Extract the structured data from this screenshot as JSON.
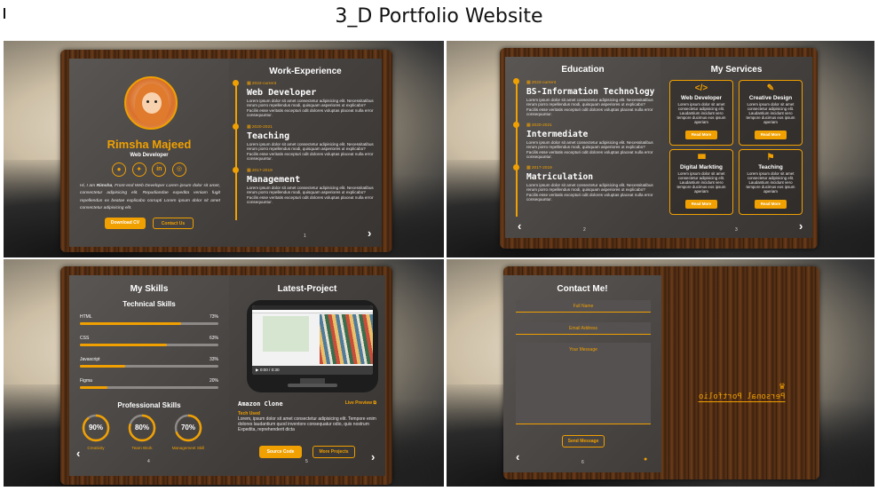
{
  "document": {
    "title": "3_D Portfolio Website"
  },
  "panel1": {
    "name": "Rimsha Majeed",
    "role": "Web Developer",
    "intro_prefix": "Hi, I am ",
    "intro_name": "Rimsha",
    "intro_rest": ", Front-end Web Developer Lorem ipsum dolor sit amet, consectetur adipisicing elit. Repudiandae expedita veniam fugit repellendus ex beatae explicabo corrupti Lorem ipsum dolor sit amet consectetur adipisicing elit.",
    "social_icons": [
      "github-icon",
      "twitter-icon",
      "linkedin-icon",
      "instagram-icon"
    ],
    "download_cv": "Download CV",
    "contact_us": "Contact Us",
    "heading": "Work-Experience",
    "items": [
      {
        "date": "2022-current",
        "title": "Web Developer",
        "text": "Lorem ipsum dolor sit amet consectetur adipisicing elit. Necessitatibus rerum porro repellendus modi, quisquam asperiores ut explicabo? Facilis esse veritatis excepturi odit dolores voluptas placeat nulla error consequuntur."
      },
      {
        "date": "2020-2021",
        "title": "Teaching",
        "text": "Lorem ipsum dolor sit amet consectetur adipisicing elit. Necessitatibus rerum porro repellendus modi, quisquam asperiores ut explicabo? Facilis esse veritatis excepturi odit dolores voluptas placeat nulla error consequuntur."
      },
      {
        "date": "2017-2019",
        "title": "Management",
        "text": "Lorem ipsum dolor sit amet consectetur adipisicing elit. Necessitatibus rerum porro repellendus modi, quisquam asperiores ut explicabo? Facilis esse veritatis excepturi odit dolores voluptas placeat nulla error consequuntur."
      }
    ],
    "page_number": "1",
    "next": "›"
  },
  "panel2": {
    "heading": "Education",
    "items": [
      {
        "date": "2022-current",
        "title": "BS-Information Technology",
        "text": "Lorem ipsum dolor sit amet consectetur adipisicing elit. Necessitatibus rerum porro repellendus modi, quisquam asperiores ut explicabo? Facilis esse veritatis excepturi odit dolores voluptas placeat nulla error consequuntur."
      },
      {
        "date": "2020-2021",
        "title": "Intermediate",
        "text": "Lorem ipsum dolor sit amet consectetur adipisicing elit. Necessitatibus rerum porro repellendus modi, quisquam asperiores ut explicabo? Facilis esse veritatis excepturi odit dolores voluptas placeat nulla error consequuntur."
      },
      {
        "date": "2017-2019",
        "title": "Matriculation",
        "text": "Lorem ipsum dolor sit amet consectetur adipisicing elit. Necessitatibus rerum porro repellendus modi, quisquam asperiores ut explicabo? Facilis esse veritatis excepturi odit dolores voluptas placeat nulla error consequuntur."
      }
    ],
    "services_heading": "My Services",
    "services": [
      {
        "icon": "code-icon",
        "glyph": "</>",
        "title": "Web Developer",
        "text": "Lorem ipsum dolor sit amet consectetur adipisicing elit. Laudantium incidunt vero tempore ducimus eos ipsum aperiam",
        "button": "Read More"
      },
      {
        "icon": "brush-icon",
        "glyph": "✎",
        "title": "Creative Design",
        "text": "Lorem ipsum dolor sit amet consectetur adipisicing elit. Laudantium incidunt vero tempore ducimus eos ipsum aperiam",
        "button": "Read More"
      },
      {
        "icon": "chart-icon",
        "glyph": "▮▮▮",
        "title": "Digital Markting",
        "text": "Lorem ipsum dolor sit amet consectetur adipisicing elit. Laudantium incidunt vero tempore ducimus eos ipsum aperiam",
        "button": "Read More"
      },
      {
        "icon": "teacher-icon",
        "glyph": "⚑",
        "title": "Teaching",
        "text": "Lorem ipsum dolor sit amet consectetur adipisicing elit. Laudantium incidunt vero tempore ducimus eos ipsum aperiam",
        "button": "Read More"
      }
    ],
    "page_left": "2",
    "page_right": "3",
    "prev": "‹",
    "next": "›"
  },
  "panel3": {
    "heading": "My Skills",
    "tech_heading": "Technical Skills",
    "skills": [
      {
        "name": "HTML",
        "pct_label": "73%",
        "value": 73
      },
      {
        "name": "CSS",
        "pct_label": "63%",
        "value": 63
      },
      {
        "name": "Javascript",
        "pct_label": "33%",
        "value": 33
      },
      {
        "name": "Figma",
        "pct_label": "20%",
        "value": 20
      }
    ],
    "prof_heading": "Professional Skills",
    "rings": [
      {
        "pct_label": "90%",
        "value": 90,
        "label": "Creativity"
      },
      {
        "pct_label": "80%",
        "value": 80,
        "label": "Team Work"
      },
      {
        "pct_label": "70%",
        "value": 70,
        "label": "Management Skill"
      }
    ],
    "project_heading": "Latest-Project",
    "video_time": "0:00 / 0:30",
    "project_title": "Amazon Clone",
    "live_preview": "Live Preview",
    "tech_used": "Tech Used",
    "project_text": "Lorem, ipsum dolor sit amet consectetur adipisicing elit. Tempore enim dolores laudantium quod inventore consequatur odio, quis nostrum Expedita, reprehenderit dicta",
    "source_code": "Source Code",
    "more_projects": "More Projects",
    "page_left": "4",
    "page_right": "5",
    "prev": "‹",
    "next": "›"
  },
  "panel4": {
    "heading": "Contact Me!",
    "full_name": "Full Name",
    "email": "Email Address",
    "message": "Your Message",
    "send": "Send Message",
    "cover_text": "Personal Portfolio",
    "page_number": "6",
    "prev": "‹"
  }
}
